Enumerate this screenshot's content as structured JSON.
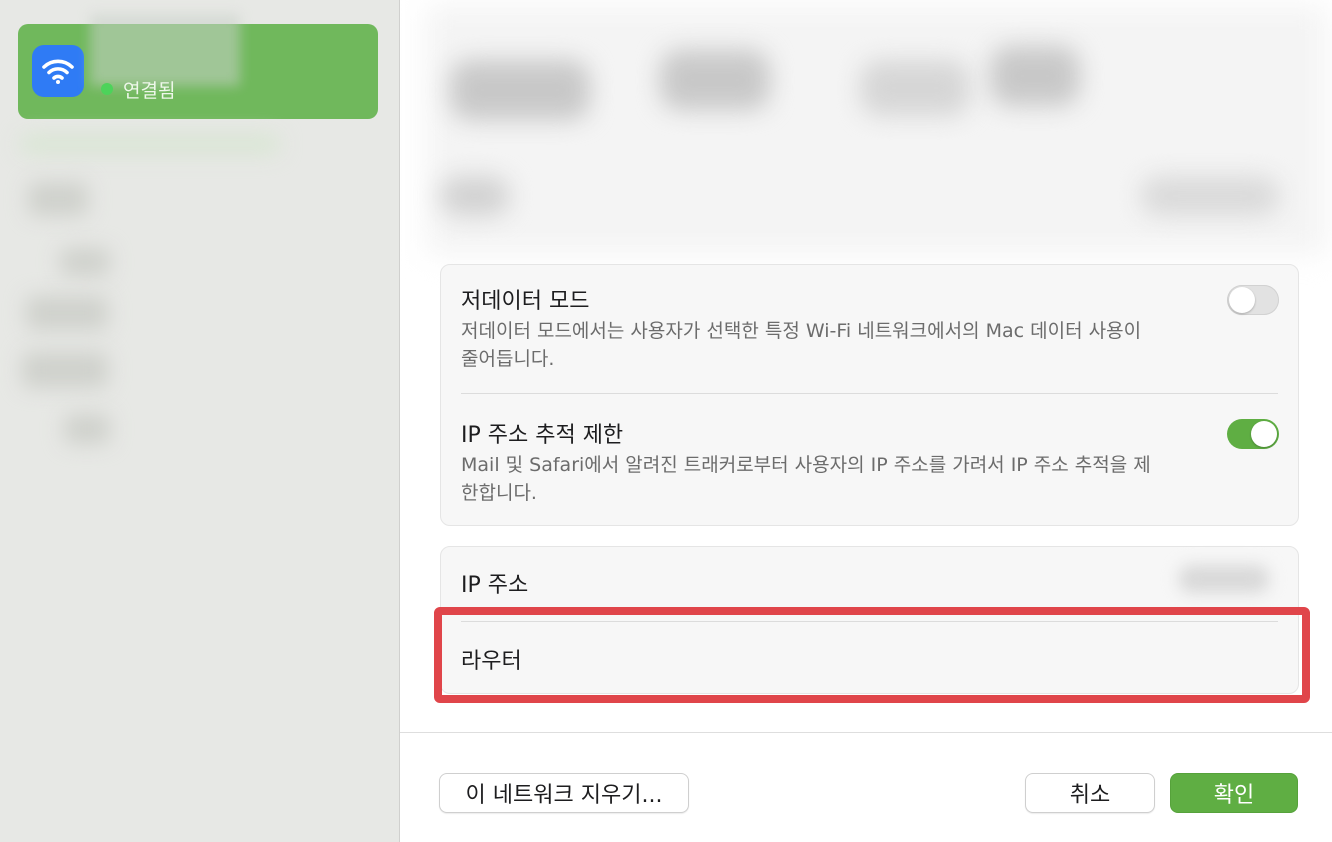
{
  "sidebar": {
    "network": {
      "status": "연결됨",
      "icon": "wifi-icon"
    }
  },
  "main": {
    "low_data_mode": {
      "title": "저데이터 모드",
      "description": "저데이터 모드에서는 사용자가 선택한 특정 Wi-Fi 네트워크에서의 Mac 데이터 사용이 줄어듭니다.",
      "enabled": false
    },
    "limit_ip_tracking": {
      "title": "IP 주소 추적 제한",
      "description": "Mail 및 Safari에서 알려진 트래커로부터 사용자의 IP 주소를 가려서 IP 주소 추적을 제한합니다.",
      "enabled": true
    },
    "ip_address": {
      "label": "IP 주소"
    },
    "router": {
      "label": "라우터"
    }
  },
  "footer": {
    "forget_button": "이 네트워크 지우기...",
    "cancel_button": "취소",
    "ok_button": "확인"
  },
  "colors": {
    "accent_green": "#5fae43",
    "highlight_red": "#e0454a",
    "wifi_blue": "#2f7bf5"
  }
}
